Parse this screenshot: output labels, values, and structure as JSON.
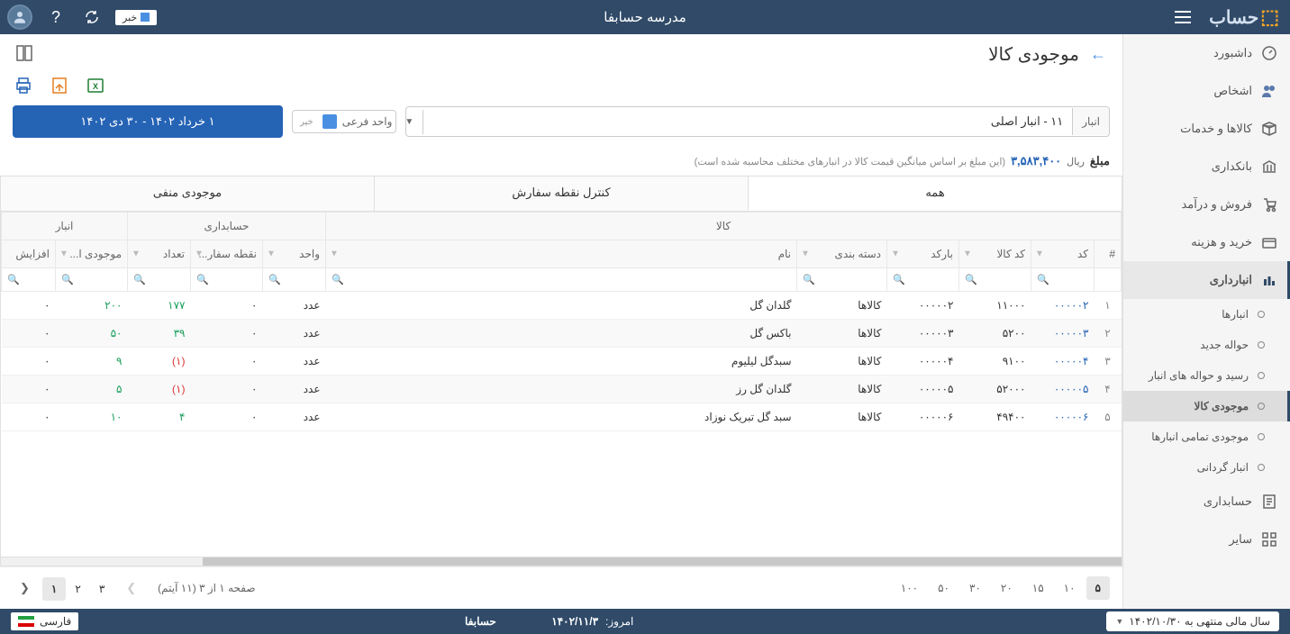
{
  "header": {
    "app_title": "مدرسه حسابفا",
    "logo_brand": "حساب",
    "news_label": "خبر"
  },
  "sidebar": {
    "items": [
      {
        "label": "داشبورد",
        "icon": "dashboard"
      },
      {
        "label": "اشخاص",
        "icon": "people"
      },
      {
        "label": "کالاها و خدمات",
        "icon": "box"
      },
      {
        "label": "بانکداری",
        "icon": "bank"
      },
      {
        "label": "فروش و درآمد",
        "icon": "sale"
      },
      {
        "label": "خرید و هزینه",
        "icon": "buy"
      },
      {
        "label": "انبارداری",
        "icon": "warehouse",
        "active": true
      },
      {
        "label": "حسابداری",
        "icon": "accounting"
      },
      {
        "label": "سایر",
        "icon": "other"
      }
    ],
    "sub_items": [
      {
        "label": "انبارها"
      },
      {
        "label": "حواله جدید"
      },
      {
        "label": "رسید و حواله های انبار"
      },
      {
        "label": "موجودی کالا",
        "active": true
      },
      {
        "label": "موجودی تمامی انبارها"
      },
      {
        "label": "انبار گردانی"
      }
    ]
  },
  "page": {
    "title": "موجودی کالا",
    "filters": {
      "warehouse_label": "انبار",
      "warehouse_value": "۱۱ - انبار اصلی",
      "subunit_label": "واحد فرعی",
      "subunit_toggle": "خیر",
      "date_range": "۱ خرداد ۱۴۰۲ - ۳۰ دی ۱۴۰۲"
    },
    "amount": {
      "label": "مبلغ",
      "value": "۳,۵۸۳,۴۰۰",
      "unit": "ریال",
      "note": "(این مبلغ بر اساس میانگین قیمت کالا در انبارهای مختلف محاسبه شده است)"
    },
    "tabs": [
      {
        "label": "همه",
        "active": true
      },
      {
        "label": "کنترل نقطه سفارش"
      },
      {
        "label": "موجودی منفی"
      }
    ],
    "columns": {
      "group_item": "کالا",
      "group_acc": "حسابداری",
      "group_wh": "انبار",
      "num": "#",
      "code": "کد",
      "item_code": "کد کالا",
      "barcode": "بارکد",
      "category": "دسته بندی",
      "name": "نام",
      "unit": "واحد",
      "reorder": "نقطه سفار...",
      "qty": "تعداد",
      "first_inv": "موجودی ا...",
      "increase": "افزایش"
    },
    "rows": [
      {
        "num": "۱",
        "code": "۰۰۰۰۰۲",
        "item_code": "۱۱۰۰۰",
        "barcode": "۰۰۰۰۰۲",
        "category": "کالاها",
        "name": "گلدان گل",
        "unit": "عدد",
        "reorder": "۰",
        "qty": "۱۷۷",
        "qty_class": "pos",
        "first_inv": "۲۰۰",
        "first_class": "pos",
        "increase": "۰"
      },
      {
        "num": "۲",
        "code": "۰۰۰۰۰۳",
        "item_code": "۵۲۰۰",
        "barcode": "۰۰۰۰۰۳",
        "category": "کالاها",
        "name": "باکس گل",
        "unit": "عدد",
        "reorder": "۰",
        "qty": "۳۹",
        "qty_class": "pos",
        "first_inv": "۵۰",
        "first_class": "pos",
        "increase": "۰"
      },
      {
        "num": "۳",
        "code": "۰۰۰۰۰۴",
        "item_code": "۹۱۰۰",
        "barcode": "۰۰۰۰۰۴",
        "category": "کالاها",
        "name": "سبدگل لیلیوم",
        "unit": "عدد",
        "reorder": "۰",
        "qty": "(۱)",
        "qty_class": "neg",
        "first_inv": "۹",
        "first_class": "pos",
        "increase": "۰"
      },
      {
        "num": "۴",
        "code": "۰۰۰۰۰۵",
        "item_code": "۵۲۰۰۰",
        "barcode": "۰۰۰۰۰۵",
        "category": "کالاها",
        "name": "گلدان گل رز",
        "unit": "عدد",
        "reorder": "۰",
        "qty": "(۱)",
        "qty_class": "neg",
        "first_inv": "۵",
        "first_class": "pos",
        "increase": "۰"
      },
      {
        "num": "۵",
        "code": "۰۰۰۰۰۶",
        "item_code": "۴۹۴۰۰",
        "barcode": "۰۰۰۰۰۶",
        "category": "کالاها",
        "name": "سبد گل تبریک نوزاد",
        "unit": "عدد",
        "reorder": "۰",
        "qty": "۴",
        "qty_class": "pos",
        "first_inv": "۱۰",
        "first_class": "pos",
        "increase": "۰"
      }
    ],
    "pager": {
      "sizes": [
        "۵",
        "۱۰",
        "۱۵",
        "۲۰",
        "۳۰",
        "۵۰",
        "۱۰۰"
      ],
      "active_size": "۵",
      "info": "صفحه ۱ از ۳ (۱۱ آیتم)",
      "pages": [
        "۱",
        "۲",
        "۳"
      ],
      "active_page": "۱"
    }
  },
  "footer": {
    "fiscal_year": "سال مالی منتهی به ۱۴۰۲/۱۰/۳۰",
    "today_label": "امروز:",
    "today_value": "۱۴۰۲/۱۱/۳",
    "brand": "حسابفا",
    "lang": "فارسی"
  }
}
